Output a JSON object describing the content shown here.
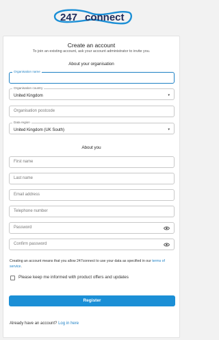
{
  "brand": {
    "number": "247",
    "word": "connect",
    "color": "#1b8fd6"
  },
  "header": {
    "title": "Create an account",
    "subtitle": "To join an existing account, ask your account administrator to invite you."
  },
  "sections": {
    "organisation": "About your organisation",
    "you": "About you"
  },
  "org_fields": {
    "org_name": {
      "label": "Organisation name",
      "value": ""
    },
    "org_country": {
      "label": "Organisation country",
      "value": "United Kingdom"
    },
    "org_postcode": {
      "placeholder": "Organisation postcode"
    },
    "data_region": {
      "label": "Data region",
      "value": "United Kingdom (UK South)"
    }
  },
  "you_fields": {
    "first_name": {
      "placeholder": "First name"
    },
    "last_name": {
      "placeholder": "Last name"
    },
    "email": {
      "placeholder": "Email address"
    },
    "telephone": {
      "placeholder": "Telephone number"
    },
    "password": {
      "placeholder": "Password"
    },
    "confirm_password": {
      "placeholder": "Confirm password"
    }
  },
  "terms": {
    "text": "Creating an account means that you allow 247connect to use your data as specified in our",
    "link": "terms of service",
    "end": "."
  },
  "marketing": {
    "label": "Please keep me informed with product offers and updates",
    "checked": false
  },
  "register_label": "Register",
  "footer": {
    "text": "Already have an account?",
    "link": "Log in here"
  }
}
